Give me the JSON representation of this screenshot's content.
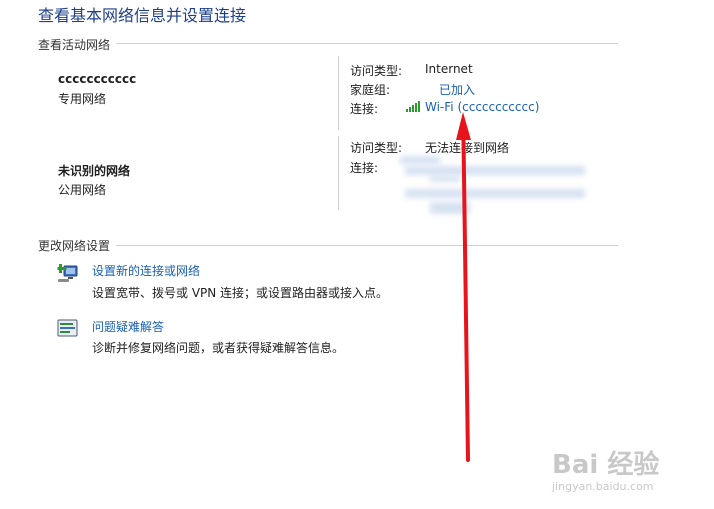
{
  "page": {
    "title": "查看基本网络信息并设置连接"
  },
  "active": {
    "header": "查看活动网络",
    "networks": [
      {
        "name": "ccccccccccc",
        "type": "专用网络",
        "access_label": "访问类型:",
        "access_value": "Internet",
        "homegroup_label": "家庭组:",
        "homegroup_value": "已加入",
        "connection_label": "连接:",
        "connection_value": "Wi-Fi (ccccccccccc)",
        "connection_icon": "wifi-signal-icon"
      },
      {
        "name": "未识别的网络",
        "type": "公用网络",
        "access_label": "访问类型:",
        "access_value": "无法连接到网络",
        "connection_label": "连接:"
      }
    ]
  },
  "settings": {
    "header": "更改网络设置",
    "items": [
      {
        "title": "设置新的连接或网络",
        "desc": "设置宽带、拨号或 VPN 连接；或设置路由器或接入点。",
        "icon": "new-connection-icon"
      },
      {
        "title": "问题疑难解答",
        "desc": "诊断并修复网络问题，或者获得疑难解答信息。",
        "icon": "troubleshoot-icon"
      }
    ]
  },
  "colors": {
    "title": "#1e3f8a",
    "link": "#1a5fb4",
    "arrow": "#e8141b"
  },
  "watermark": {
    "brand": "Bai 经验",
    "url": "jingyan.baidu.com"
  }
}
